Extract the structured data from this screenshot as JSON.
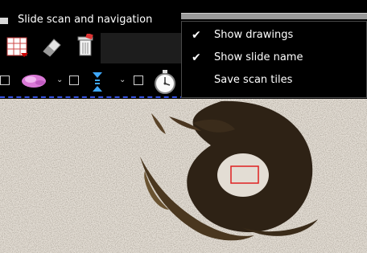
{
  "window": {
    "title": "Slide scan and navigation"
  },
  "menu": {
    "items": [
      {
        "label": "Show drawings",
        "checked": true
      },
      {
        "label": "Show slide name",
        "checked": true
      },
      {
        "label": "Save scan tiles",
        "checked": false
      }
    ]
  },
  "toolbar": {
    "icons": [
      "grid-icon",
      "eraser-icon",
      "trash-icon",
      "tissue-icon",
      "focus-icon",
      "timer-icon"
    ]
  },
  "colors": {
    "accent": "#3a56e6",
    "roi": "#e02020",
    "slide_bg": "#e3ddd4"
  }
}
